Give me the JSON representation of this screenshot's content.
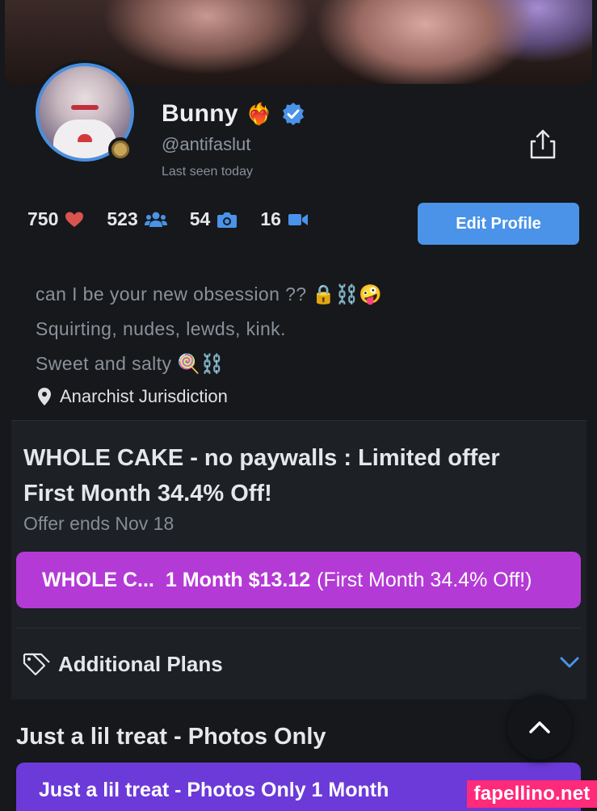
{
  "profile": {
    "name": "Bunny",
    "name_emoji": "❤️‍🔥",
    "handle": "@antifaslut",
    "last_seen": "Last seen today"
  },
  "stats": {
    "likes": "750",
    "subscribers": "523",
    "photos": "54",
    "videos": "16"
  },
  "actions": {
    "edit_profile": "Edit Profile"
  },
  "bio": {
    "line1": "can I be your new obsession ?? 🔒⛓️🤪",
    "line2": "Squirting, nudes, lewds, kink.",
    "line3": "Sweet and salty 🍭⛓️",
    "location": "Anarchist Jurisdiction"
  },
  "offer": {
    "title": "WHOLE CAKE - no paywalls : Limited offer",
    "subtitle": "First Month 34.4% Off!",
    "ends": "Offer ends Nov 18",
    "plan_name": "WHOLE C...",
    "plan_duration_price": "1 Month $13.12",
    "plan_discount": "(First Month 34.4% Off!)"
  },
  "additional_plans": {
    "label": "Additional Plans"
  },
  "plan_section": {
    "title": "Just a lil treat - Photos Only",
    "button_text": "Just a lil treat - Photos Only 1  Month"
  },
  "watermark": "fapellino.net",
  "colors": {
    "accent_blue": "#4a93e8",
    "plan_purple": "#b43ad6",
    "plan2_violet": "#6b3ad8",
    "heart": "#d9534f",
    "watermark_pink": "#ff2a79"
  },
  "icons": [
    "verified-badge-icon",
    "share-icon",
    "heart-icon",
    "users-icon",
    "camera-icon",
    "video-icon",
    "location-pin-icon",
    "tag-icon",
    "chevron-down-icon",
    "chevron-up-icon"
  ]
}
